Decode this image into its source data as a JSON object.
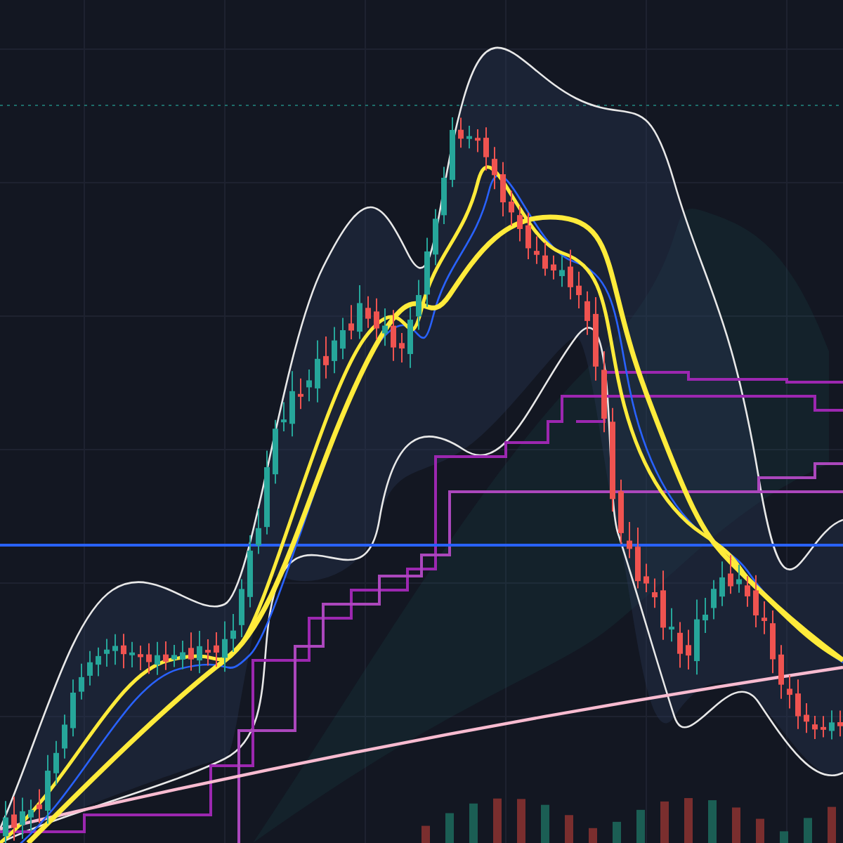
{
  "chart": {
    "kind": "candlestick"
  }
}
